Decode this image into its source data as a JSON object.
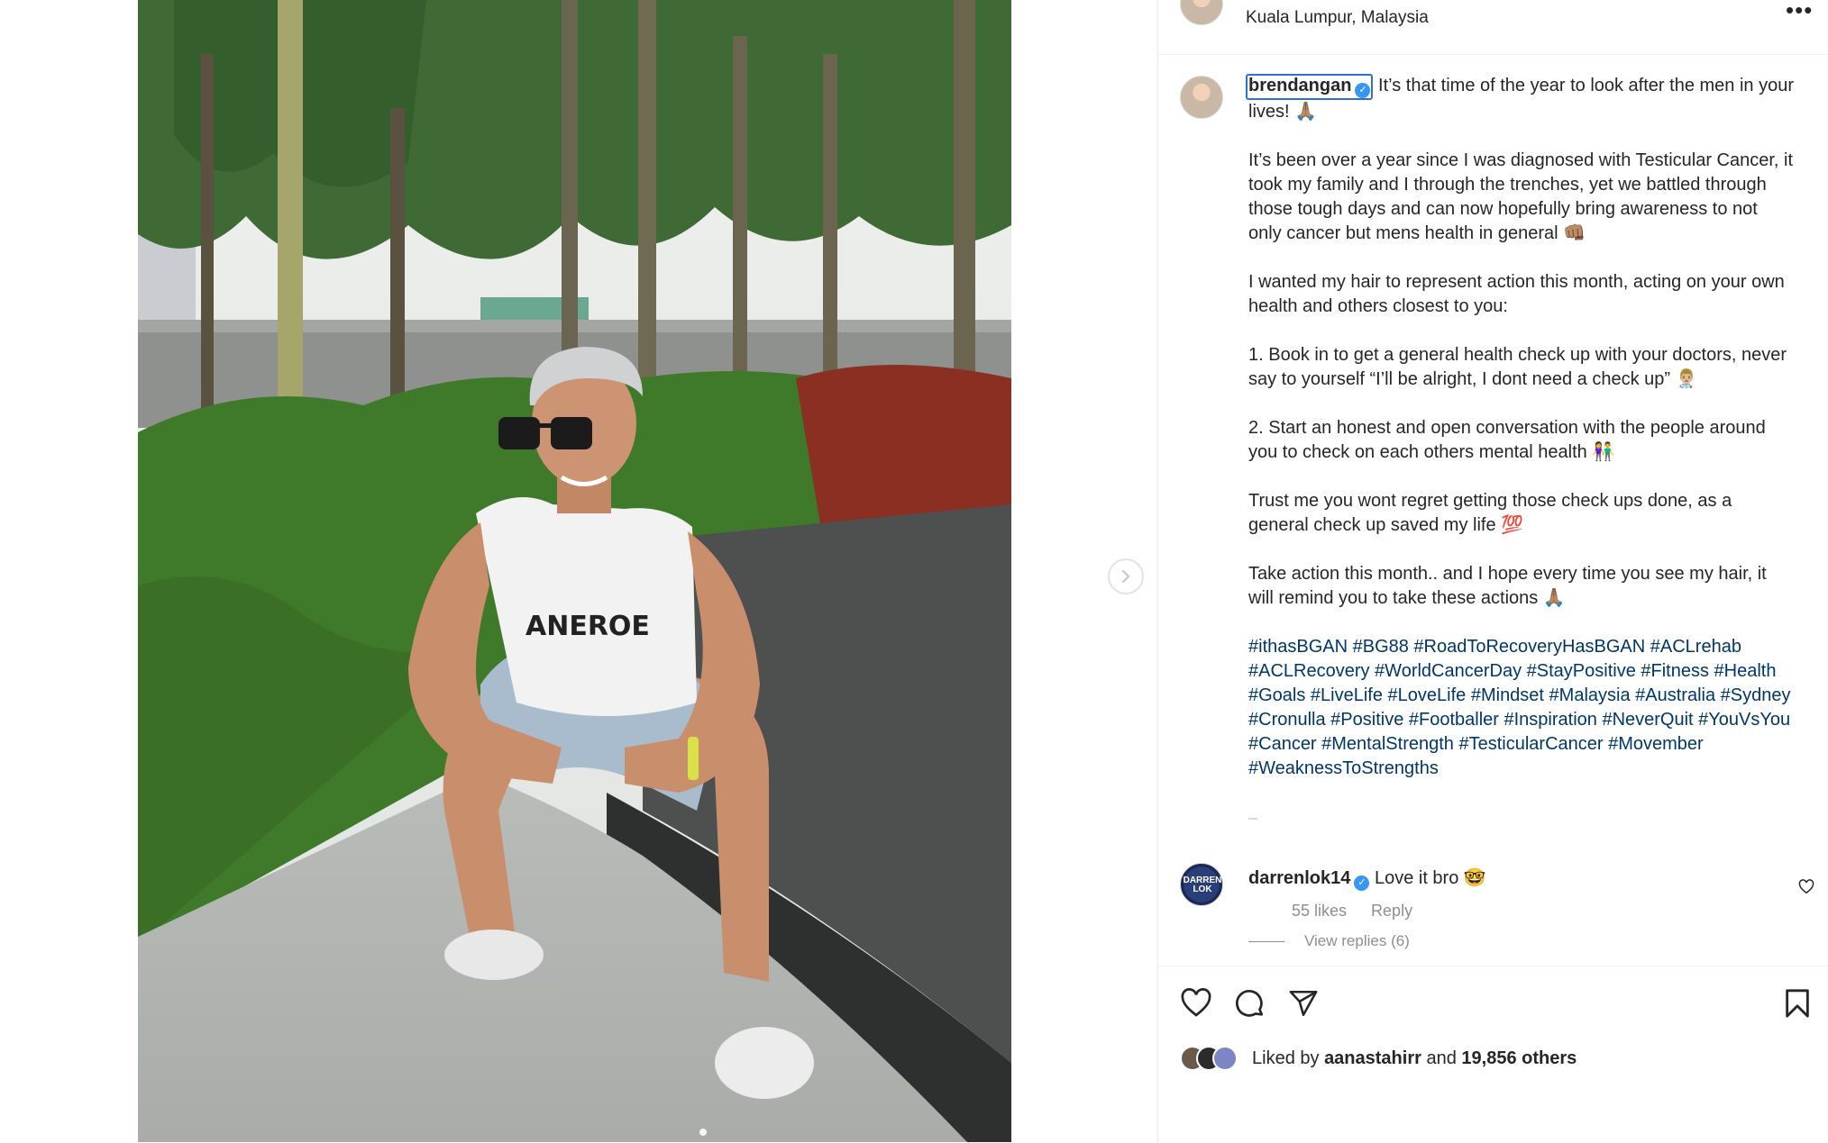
{
  "post": {
    "location": "Kuala Lumpur, Malaysia",
    "author": "brendangan",
    "caption_lead": " It’s that time of the year to look after the men in your lives! 🙏🏽",
    "paragraphs": [
      "It’s been over a year since I was diagnosed with Testicular Cancer, it took my family and I through the trenches, yet we battled through those tough days and can now hopefully bring awareness to not only cancer but mens health in general 👊🏽",
      "I wanted my hair to represent action this month, acting on your own health and others closest to you:",
      "1. Book in to get a general health check up with your doctors, never say to yourself “I’ll be alright, I dont need a check up” 👨🏼‍⚕️",
      "2. Start an honest and open conversation with the people around you to check on each others mental health 👫",
      "Trust me you wont regret getting those check ups done, as a general check up saved my life 💯",
      "Take action this month.. and I hope every time you see my hair, it will remind you to take these actions 🙏🏽"
    ],
    "hashtags": "#ithasBGAN #BG88 #RoadToRecoveryHasBGAN #ACLrehab #ACLRecovery #WorldCancerDay #StayPositive #Fitness #Health #Goals #LiveLife #LoveLife #Mindset #Malaysia #Australia #Sydney #Cronulla #Positive #Footballer #Inspiration #NeverQuit #YouVsYou #Cancer #MentalStrength #TesticularCancer #Movember #WeaknessToStrengths"
  },
  "comment": {
    "username": "darrenlok14",
    "text": "Love it bro 🤓",
    "avatar_text": "DARREN LOK",
    "likes": "55 likes",
    "reply": "Reply",
    "view_replies": "View replies (6)"
  },
  "likes": {
    "prefix": "Liked by",
    "user": "aanastahirr",
    "and": "and",
    "others": "19,856 others"
  },
  "colors": {
    "link": "#00376b",
    "verified": "#3897f0",
    "focus_ring": "#2f6fd6",
    "muted": "#8e8e8e"
  },
  "icons": [
    "more-icon",
    "verified-icon",
    "chevron-right-icon",
    "heart-icon",
    "comment-icon",
    "share-icon",
    "bookmark-icon"
  ]
}
